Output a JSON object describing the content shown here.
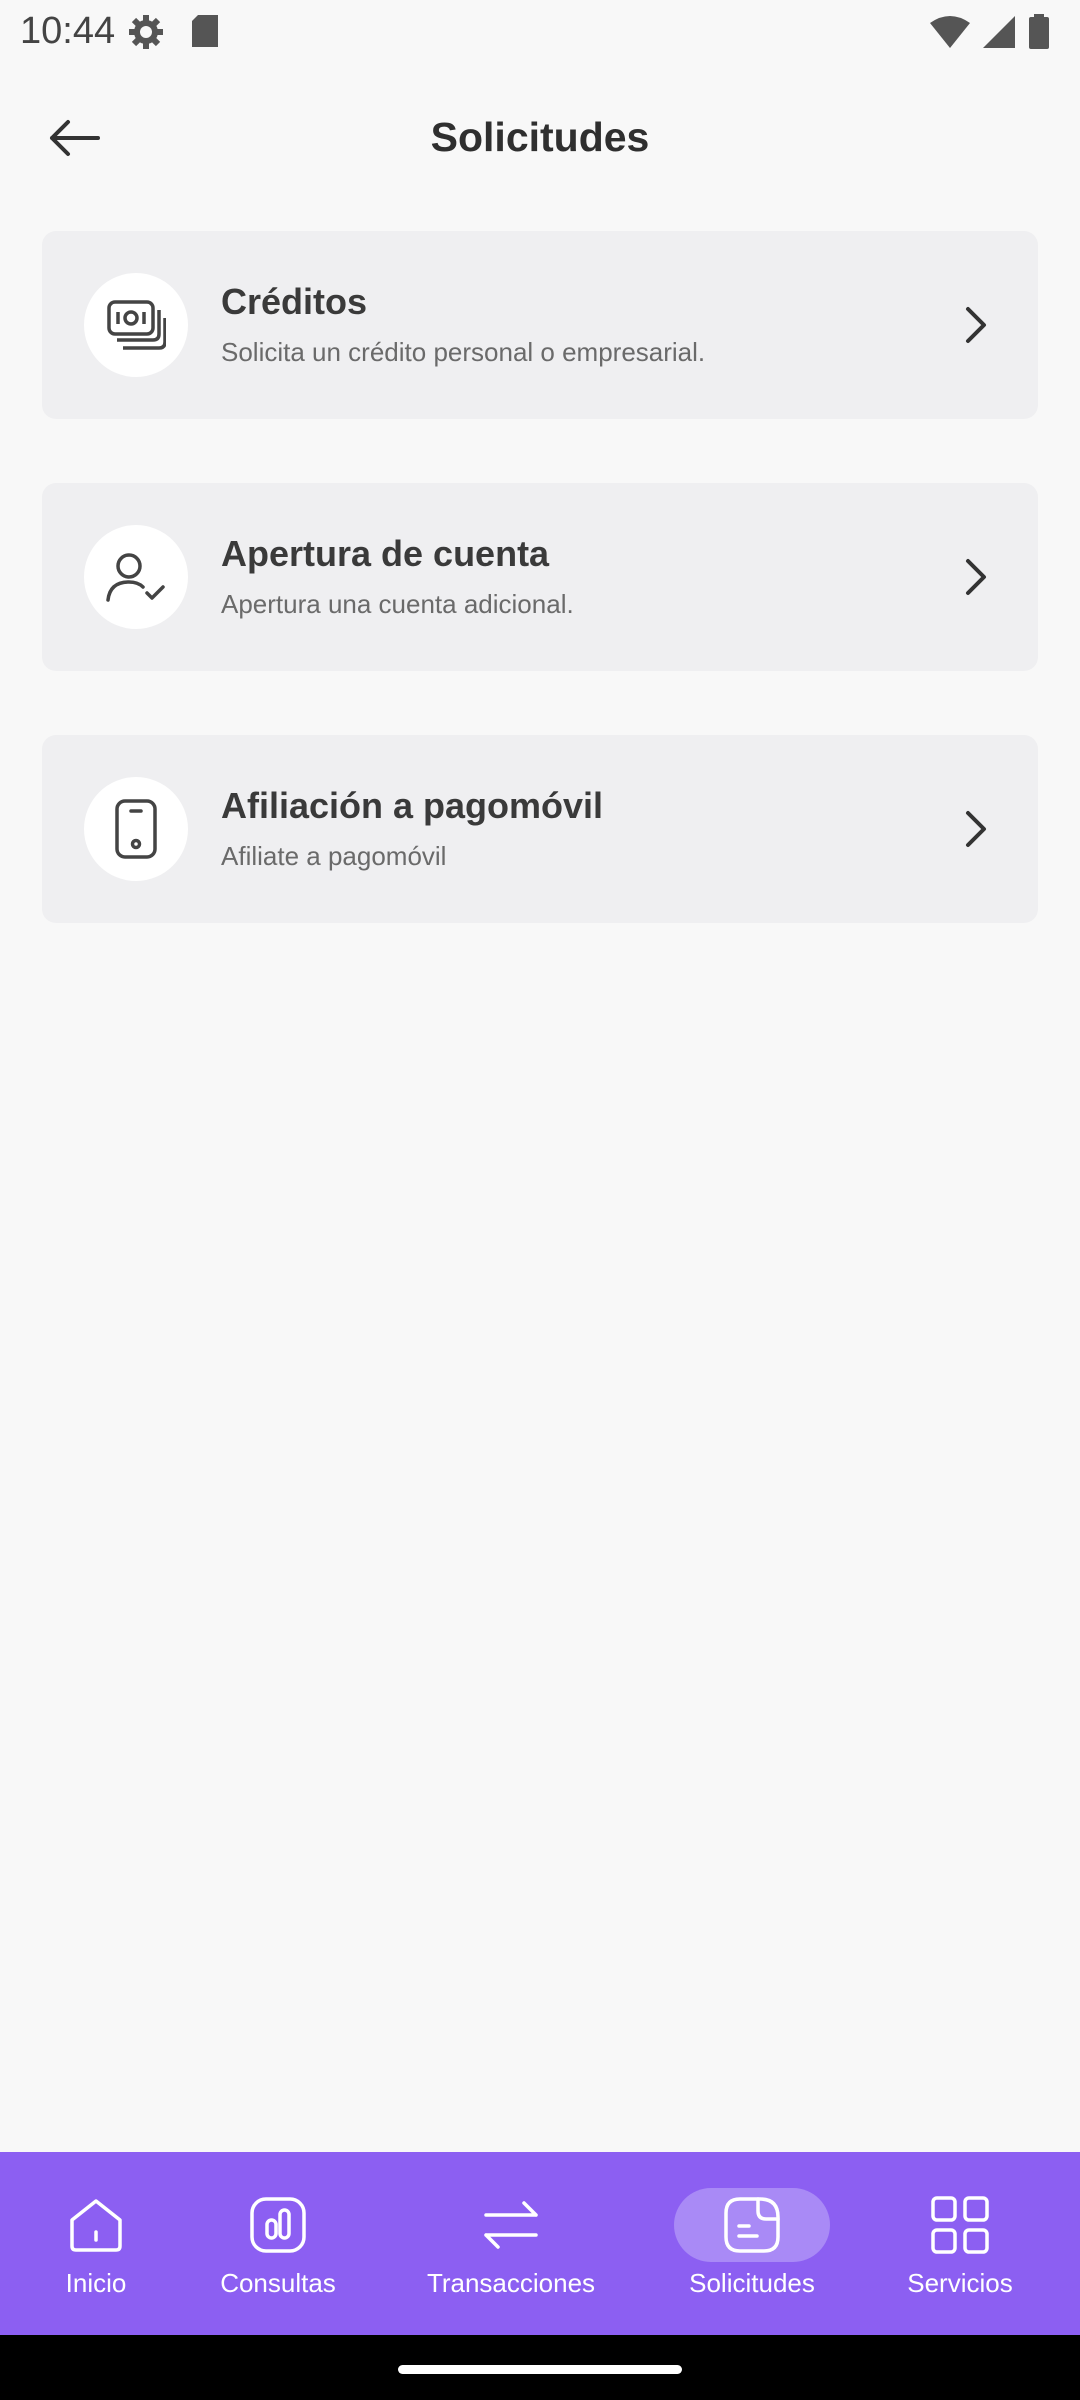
{
  "status_bar": {
    "time": "10:44",
    "left_icons": [
      "settings-gear-icon",
      "sd-card-icon"
    ],
    "right_icons": [
      "wifi-icon",
      "cellular-signal-icon",
      "battery-icon"
    ]
  },
  "header": {
    "back_icon": "arrow-left-icon",
    "title": "Solicitudes"
  },
  "cards": [
    {
      "title": "Créditos",
      "subtitle": "Solicita un crédito personal o empresarial.",
      "icon": "money-stack-icon"
    },
    {
      "title": "Apertura de cuenta",
      "subtitle": "Apertura una cuenta adicional.",
      "icon": "user-check-icon"
    },
    {
      "title": "Afiliación a pagomóvil",
      "subtitle": "Afiliate a pagomóvil",
      "icon": "mobile-phone-icon"
    }
  ],
  "bottom_nav": {
    "active": "Solicitudes",
    "items": [
      {
        "label": "Inicio",
        "icon": "home-icon"
      },
      {
        "label": "Consultas",
        "icon": "bar-chart-icon"
      },
      {
        "label": "Transacciones",
        "icon": "transfer-arrows-icon"
      },
      {
        "label": "Solicitudes",
        "icon": "document-icon"
      },
      {
        "label": "Servicios",
        "icon": "grid-icon"
      }
    ]
  },
  "colors": {
    "background": "#f8f8f8",
    "card_background": "#efeff1",
    "nav_background": "#8c5ff2",
    "nav_active_pill": "#a98af6",
    "text_primary": "#3a3a3a",
    "text_secondary": "#6a6a6a"
  }
}
